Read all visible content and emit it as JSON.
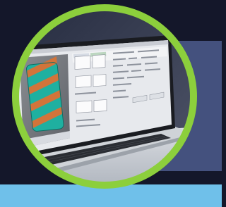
{
  "photo": {
    "background_color": "#14172a",
    "panel_color": "#44517e",
    "bottom_strip_color": "#6fc0ea",
    "ring_color": "#8ccf3c",
    "laptop_body_color": "#cfd3d8",
    "keyboard_color": "#2a2d33",
    "screen_window_color": "#e7e9ed",
    "viewport_color": "#7a7d82",
    "model_colors": [
      "#1fb0a0",
      "#d2743a"
    ]
  }
}
